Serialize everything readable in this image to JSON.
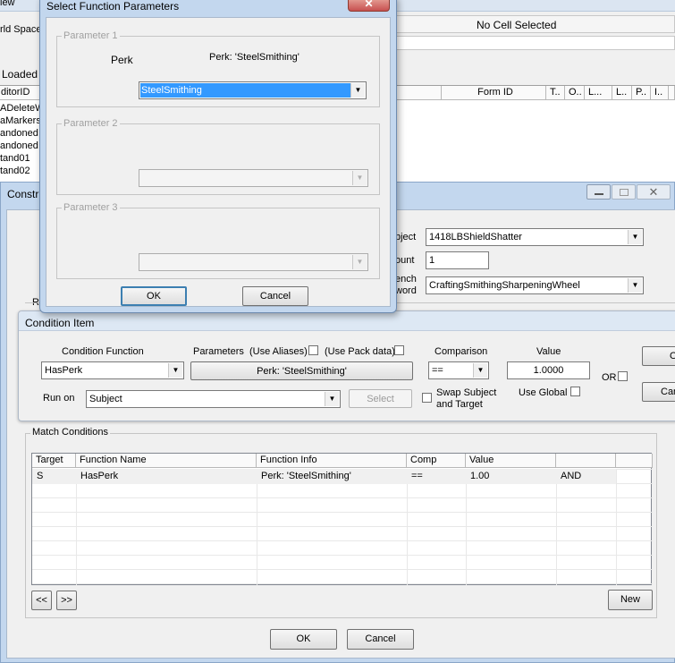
{
  "background": {
    "top_menu_fragment": "iew",
    "world_space_label": "rld Space",
    "no_cell_label": "No Cell Selected",
    "loaded_label": "Loaded a",
    "list_headers": [
      "ditorID",
      "Form ID",
      "T..",
      "O..",
      "L...",
      "L..",
      "P..",
      "I.."
    ],
    "list_rows": [
      "ADeleteW",
      "aMarkers",
      "andoned",
      "andoned",
      "tand01",
      "tand02"
    ]
  },
  "construct_window": {
    "title_fragment": "Constr",
    "labels": {
      "subject": "bject",
      "count": "ount",
      "bench_line1": "ench",
      "bench_line2": "word"
    },
    "subject_value": "1418LBShieldShatter",
    "count_value": "1",
    "bench_value": "CraftingSmithingSharpeningWheel",
    "r_label": "R"
  },
  "select_params_dialog": {
    "title": "Select Function Parameters",
    "param1": {
      "label": "Parameter 1",
      "type_label": "Perk",
      "value_label": "Perk: 'SteelSmithing'",
      "combo_value": "SteelSmithing"
    },
    "param2": {
      "label": "Parameter 2"
    },
    "param3": {
      "label": "Parameter 3"
    },
    "ok_label": "OK",
    "cancel_label": "Cancel"
  },
  "condition_item": {
    "title": "Condition Item",
    "condition_function_label": "Condition Function",
    "condition_function_value": "HasPerk",
    "parameters_label": "Parameters",
    "use_aliases_label": "(Use Aliases)",
    "use_pack_data_label": "(Use Pack data)",
    "parameters_button": "Perk: 'SteelSmithing'",
    "comparison_label": "Comparison",
    "comparison_value": "==",
    "value_label": "Value",
    "value_value": "1.0000",
    "or_label": "OR",
    "ok_fragment": "O",
    "cancel_fragment": "Car",
    "run_on_label": "Run on",
    "run_on_value": "Subject",
    "select_button": "Select",
    "swap_label_line1": "Swap Subject",
    "swap_label_line2": "and Target",
    "use_global_label": "Use Global"
  },
  "match_conditions": {
    "title": "Match Conditions",
    "columns": [
      "Target",
      "Function Name",
      "Function Info",
      "Comp",
      "Value",
      ""
    ],
    "rows": [
      {
        "target": "S",
        "function_name": "HasPerk",
        "function_info": "Perk: 'SteelSmithing'",
        "comp": "==",
        "value": "1.00",
        "op": "AND"
      }
    ],
    "prev_button": "<<",
    "next_button": ">>",
    "new_button": "New"
  },
  "bottom_buttons": {
    "ok": "OK",
    "cancel": "Cancel"
  },
  "colors": {
    "window_face": "#f0f0f0",
    "selection": "#3399ff",
    "close_red": "#c75050",
    "frame_blue": "#c3d7ee"
  }
}
